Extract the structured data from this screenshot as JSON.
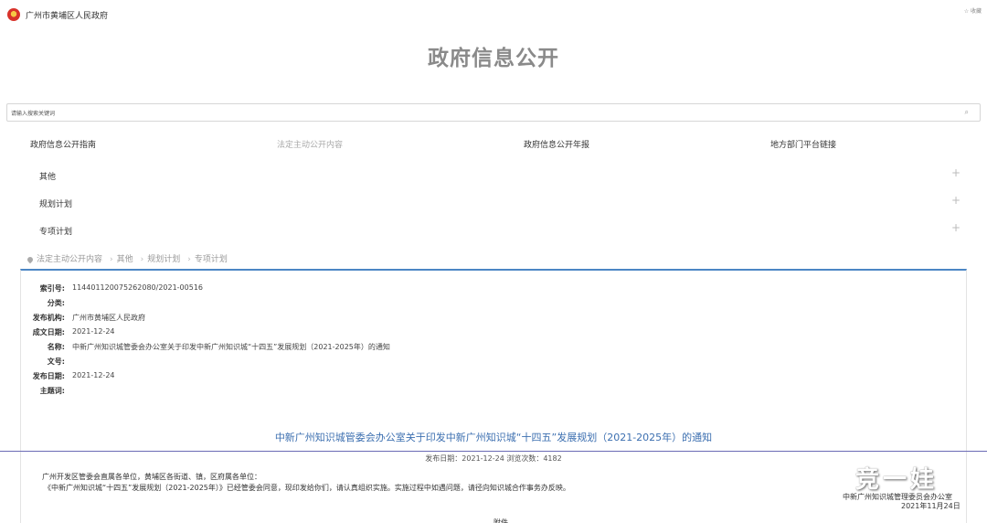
{
  "header": {
    "site_name": "广州市黄埔区人民政府",
    "favorite_label": "☆ 收藏",
    "title": "政府信息公开"
  },
  "search": {
    "placeholder": "请输入搜索关键词",
    "icon": "search-icon"
  },
  "nav": [
    {
      "label": "政府信息公开指南",
      "active": false
    },
    {
      "label": "法定主动公开内容",
      "active": true
    },
    {
      "label": "政府信息公开年报",
      "active": false
    },
    {
      "label": "地方部门平台链接",
      "active": false
    }
  ],
  "accordion": [
    {
      "label": "其他",
      "toggle": "+"
    },
    {
      "label": "规划计划",
      "toggle": "+"
    },
    {
      "label": "专项计划",
      "toggle": "+"
    }
  ],
  "breadcrumb": [
    "法定主动公开内容",
    "其他",
    "规划计划",
    "专项计划"
  ],
  "breadcrumb_sep": "›",
  "meta": [
    {
      "key": "索引号:",
      "value": "114401120075262080/2021-00516"
    },
    {
      "key": "分类:",
      "value": ""
    },
    {
      "key": "发布机构:",
      "value": "广州市黄埔区人民政府"
    },
    {
      "key": "成文日期:",
      "value": "2021-12-24"
    },
    {
      "key": "名称:",
      "value": "中新广州知识城管委会办公室关于印发中新广州知识城“十四五”发展规划（2021-2025年）的通知"
    },
    {
      "key": "文号:",
      "value": ""
    },
    {
      "key": "发布日期:",
      "value": "2021-12-24"
    },
    {
      "key": "主题词:",
      "value": ""
    }
  ],
  "document": {
    "title": "中新广州知识城管委会办公室关于印发中新广州知识城“十四五”发展规划（2021-2025年）的通知",
    "pub_info": "发布日期：2021-12-24   浏览次数：4182",
    "body": [
      "广州开发区管委会直属各单位，黄埔区各街道、镇，区府属各单位：",
      "《中新广州知识城“十四五”发展规划（2021-2025年）》已经管委会同意，现印发给你们，请认真组织实施。实施过程中如遇问题，请径向知识城合作事务办反映。"
    ],
    "signer": "中新广州知识城管理委员会办公室",
    "sign_date": "2021年11月24日",
    "cutoff_text": "附件"
  },
  "watermark": "竞一娃"
}
